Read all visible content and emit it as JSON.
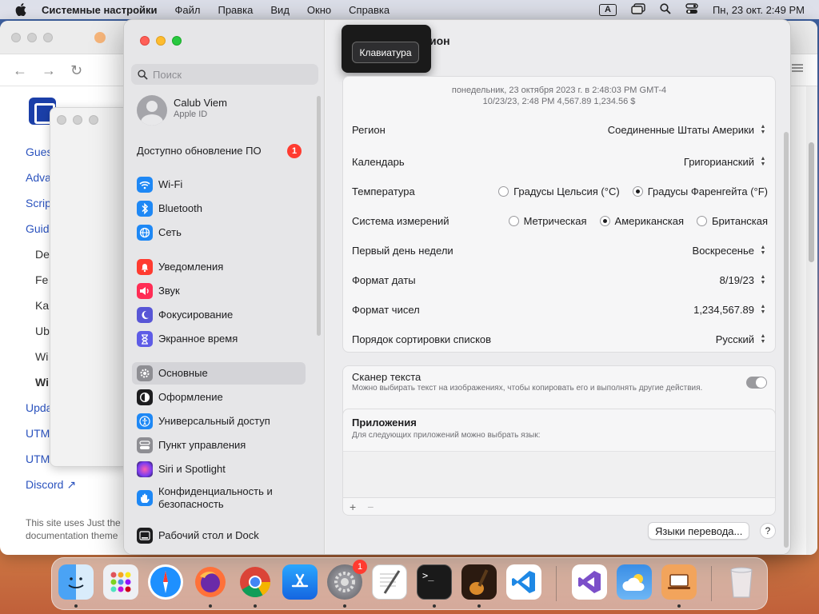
{
  "menubar": {
    "items": [
      "Системные настройки",
      "Файл",
      "Правка",
      "Вид",
      "Окно",
      "Справка"
    ],
    "input_indicator": "A",
    "datetime": "Пн, 23 окт.  2:49 PM"
  },
  "browser": {
    "links": [
      "Gues",
      "Adva",
      "Scrip",
      "Guid",
      "De",
      "Fe",
      "Ka",
      "Ub",
      "Wi",
      "Wi",
      "Upda",
      "UTM",
      "UTM",
      "Discord"
    ],
    "footnote_line1": "This site uses Just the",
    "footnote_line2": "documentation theme"
  },
  "sidebar": {
    "search_placeholder": "Поиск",
    "profile_name": "Calub Viem",
    "profile_sub": "Apple ID",
    "update_label": "Доступно обновление ПО",
    "update_count": "1",
    "items": [
      {
        "label": "Wi-Fi",
        "icon": "wifi-icon",
        "color": "#1e88f5"
      },
      {
        "label": "Bluetooth",
        "icon": "bluetooth-icon",
        "color": "#1e88f5"
      },
      {
        "label": "Сеть",
        "icon": "globe-icon",
        "color": "#1e88f5"
      },
      {
        "label": "Уведомления",
        "icon": "bell-icon",
        "color": "#ff3b30"
      },
      {
        "label": "Звук",
        "icon": "speaker-icon",
        "color": "#ff2d55"
      },
      {
        "label": "Фокусирование",
        "icon": "moon-icon",
        "color": "#5856d6"
      },
      {
        "label": "Экранное время",
        "icon": "hourglass-icon",
        "color": "#5e5ce6"
      },
      {
        "label": "Основные",
        "icon": "gear-icon",
        "color": "#8e8e93"
      },
      {
        "label": "Оформление",
        "icon": "appearance-icon",
        "color": "#1d1d1f"
      },
      {
        "label": "Универсальный доступ",
        "icon": "accessibility-icon",
        "color": "#1e88f5"
      },
      {
        "label": "Пункт управления",
        "icon": "control-center-icon",
        "color": "#8e8e93"
      },
      {
        "label": "Siri и Spotlight",
        "icon": "siri-icon",
        "color": "#af52de"
      },
      {
        "label": "Конфиденциальность и безопасность",
        "icon": "hand-icon",
        "color": "#1e88f5"
      },
      {
        "label": "Рабочий стол и Dock",
        "icon": "dock-icon",
        "color": "#1d1d1f"
      }
    ]
  },
  "content": {
    "title": "ион",
    "tooltip": "Клавиатура",
    "preview_line1": "понедельник, 23 октября 2023 г. в 2:48:03 PM GMT-4",
    "preview_line2": "10/23/23, 2:48 PM      4,567.89      1,234.56 $",
    "region_label": "Регион",
    "region_value": "Соединенные Штаты Америки",
    "calendar_label": "Календарь",
    "calendar_value": "Григорианский",
    "temp_label": "Температура",
    "temp_c": "Градусы Цельсия (°C)",
    "temp_f": "Градусы Фаренгейта (°F)",
    "measure_label": "Система измерений",
    "measure_metric": "Метрическая",
    "measure_us": "Американская",
    "measure_uk": "Британская",
    "firstday_label": "Первый день недели",
    "firstday_value": "Воскресенье",
    "dateformat_label": "Формат даты",
    "dateformat_value": "8/19/23",
    "numformat_label": "Формат чисел",
    "numformat_value": "1,234,567.89",
    "sort_label": "Порядок сортировки списков",
    "sort_value": "Русский",
    "scanner_label": "Сканер текста",
    "scanner_desc": "Можно выбирать текст на изображениях, чтобы копировать его и выполнять другие действия.",
    "apps_label": "Приложения",
    "apps_desc": "Для следующих приложений можно выбрать язык:",
    "plus": "+",
    "minus": "−",
    "translate_button": "Языки перевода...",
    "help": "?"
  },
  "dock": {
    "settings_badge": "1",
    "apps": [
      "finder",
      "launchpad",
      "safari",
      "firefox",
      "chrome",
      "app-store",
      "system-settings",
      "textedit",
      "terminal",
      "garageband",
      "vscode",
      "visual-studio",
      "weather",
      "utm",
      "trash"
    ]
  }
}
